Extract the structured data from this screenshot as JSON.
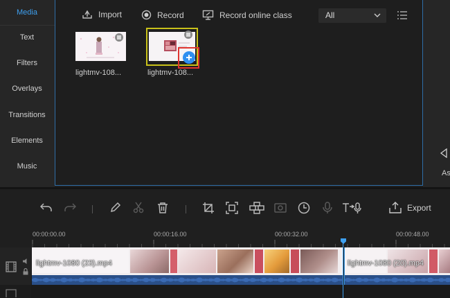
{
  "sidebar": {
    "items": [
      {
        "label": "Media",
        "active": true
      },
      {
        "label": "Text"
      },
      {
        "label": "Filters"
      },
      {
        "label": "Overlays"
      },
      {
        "label": "Transitions"
      },
      {
        "label": "Elements"
      },
      {
        "label": "Music"
      }
    ]
  },
  "media_toolbar": {
    "import_label": "Import",
    "record_label": "Record",
    "record_online_label": "Record online class",
    "filter_value": "All"
  },
  "media_items": [
    {
      "label": "lightmv-108..."
    },
    {
      "label": "lightmv-108..."
    }
  ],
  "right_panel": {
    "label": "As"
  },
  "timeline_toolbar": {
    "export_label": "Export"
  },
  "ruler": {
    "ticks": [
      "00:00:00.00",
      "00:00:16.00",
      "00:00:32.00",
      "00:00:48.00"
    ]
  },
  "track": {
    "clips": [
      {
        "name": "lightmv-1080 (23).mp4"
      },
      {
        "name": "lightmv-1080 (20).mp4"
      }
    ]
  },
  "colors": {
    "accent": "#3ea0f0",
    "selection": "#c9c21a",
    "highlight_box": "#e0342f",
    "waveform": "#2f6fc2"
  }
}
